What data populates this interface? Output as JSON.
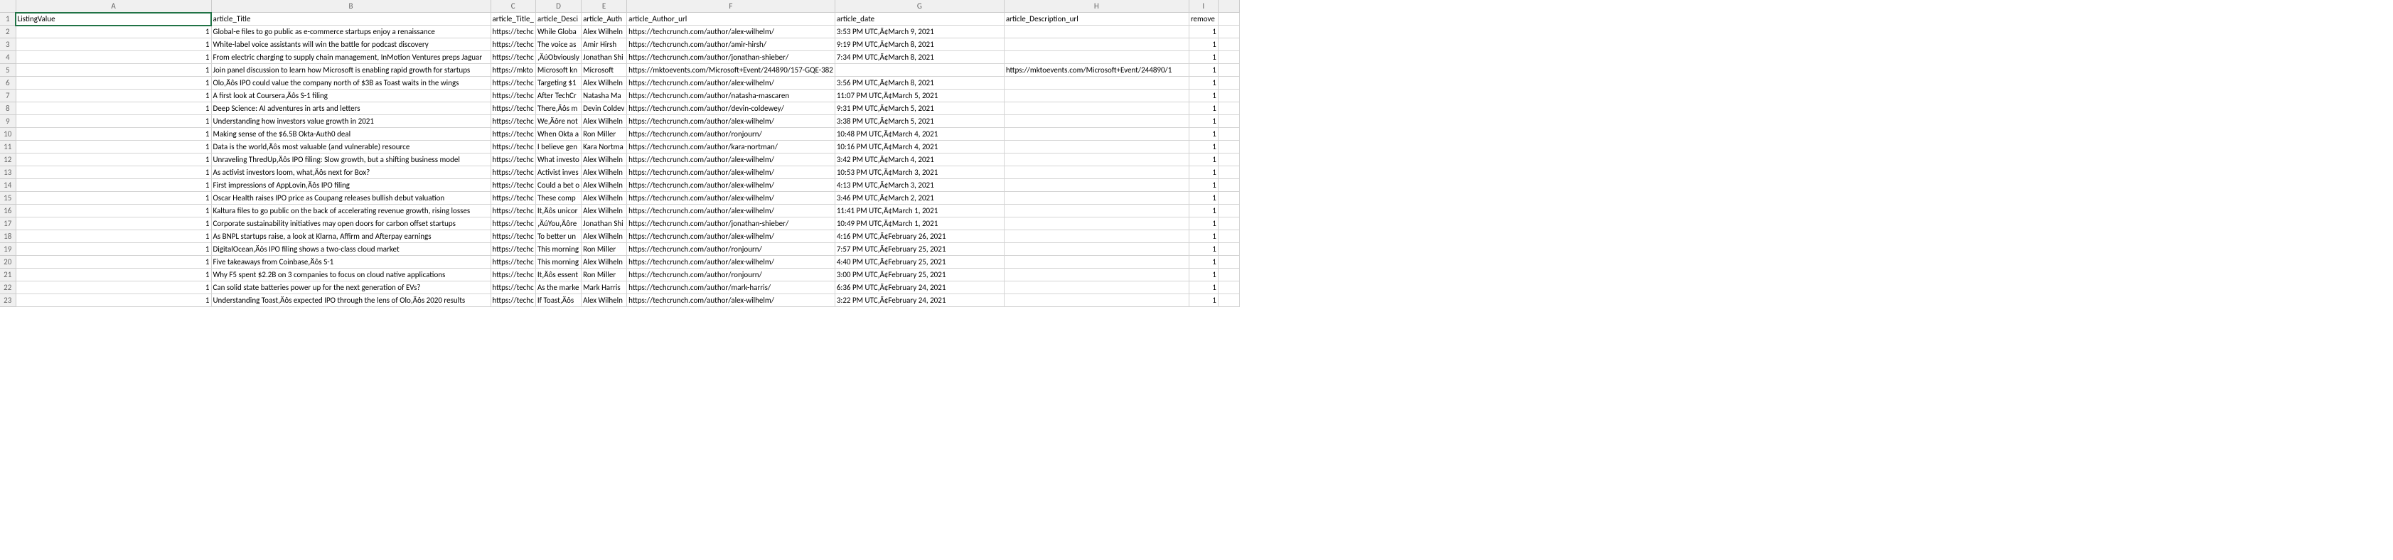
{
  "columns": [
    "A",
    "B",
    "C",
    "D",
    "E",
    "F",
    "G",
    "H",
    "I",
    ""
  ],
  "colClasses": [
    "colA",
    "colB",
    "colC",
    "colD",
    "colE",
    "colF",
    "colG",
    "colH",
    "colI",
    "colJ"
  ],
  "rowCount": 23,
  "selected": {
    "row": 1,
    "col": 0
  },
  "headers": {
    "A": "ListingValue",
    "B": "article_Title",
    "C": "article_Title_",
    "D": "article_Desci",
    "E": "article_Auth",
    "F": "article_Author_url",
    "G": "article_date",
    "H": "article_Description_url",
    "I": "remove"
  },
  "rows": [
    {
      "A": "1",
      "B": "Global-e files to go public as e-commerce startups enjoy a renaissance",
      "C": "https://techc",
      "D": "While Globa",
      "E": "Alex Wilheln",
      "F": "https://techcrunch.com/author/alex-wilhelm/",
      "G": "3:53 PM UTC‚Ä¢March 9, 2021",
      "H": "",
      "I": "1"
    },
    {
      "A": "1",
      "B": "White-label voice assistants will win the battle for podcast discovery",
      "C": "https://techc",
      "D": "The voice as",
      "E": "Amir Hirsh",
      "F": "https://techcrunch.com/author/amir-hirsh/",
      "G": "9:19 PM UTC‚Ä¢March 8, 2021",
      "H": "",
      "I": "1"
    },
    {
      "A": "1",
      "B": "From electric charging to supply chain management, InMotion Ventures preps Jaguar",
      "C": "https://techc",
      "D": "‚ÄúObviously",
      "E": "Jonathan Shi",
      "F": "https://techcrunch.com/author/jonathan-shieber/",
      "G": "7:34 PM UTC‚Ä¢March 8, 2021",
      "H": "",
      "I": "1"
    },
    {
      "A": "1",
      "B": "Join panel discussion to learn how Microsoft is enabling rapid growth for startups",
      "C": "https://mkto",
      "D": "Microsoft kn",
      "E": "Microsoft",
      "F": "https://mktoevents.com/Microsoft+Event/244890/157-GQE-382",
      "G": "",
      "H": "https://mktoevents.com/Microsoft+Event/244890/1",
      "I": "1"
    },
    {
      "A": "1",
      "B": "Olo‚Äôs IPO could value the company north of $3B as Toast waits in the wings",
      "C": "https://techc",
      "D": "Targeting $1",
      "E": "Alex Wilheln",
      "F": "https://techcrunch.com/author/alex-wilhelm/",
      "G": "3:56 PM UTC‚Ä¢March 8, 2021",
      "H": "",
      "I": "1"
    },
    {
      "A": "1",
      "B": "A first look at Coursera‚Äôs S-1 filing",
      "C": "https://techc",
      "D": "After TechCr",
      "E": "Natasha Ma",
      "F": "https://techcrunch.com/author/natasha-mascaren",
      "G": "11:07 PM UTC‚Ä¢March 5, 2021",
      "H": "",
      "I": "1"
    },
    {
      "A": "1",
      "B": "Deep Science: AI adventures in arts and letters",
      "C": "https://techc",
      "D": "There‚Äôs m",
      "E": "Devin Coldev",
      "F": "https://techcrunch.com/author/devin-coldewey/",
      "G": "9:31 PM UTC‚Ä¢March 5, 2021",
      "H": "",
      "I": "1"
    },
    {
      "A": "1",
      "B": "Understanding how investors value growth in 2021",
      "C": "https://techc",
      "D": "We‚Äôre not",
      "E": "Alex Wilheln",
      "F": "https://techcrunch.com/author/alex-wilhelm/",
      "G": "3:38 PM UTC‚Ä¢March 5, 2021",
      "H": "",
      "I": "1"
    },
    {
      "A": "1",
      "B": "Making sense of the $6.5B Okta-Auth0 deal",
      "C": "https://techc",
      "D": "When Okta a",
      "E": "Ron Miller",
      "F": "https://techcrunch.com/author/ronjourn/",
      "G": "10:48 PM UTC‚Ä¢March 4, 2021",
      "H": "",
      "I": "1"
    },
    {
      "A": "1",
      "B": "Data is the world‚Äôs most valuable (and vulnerable) resource",
      "C": "https://techc",
      "D": "I believe gen",
      "E": "Kara Nortma",
      "F": "https://techcrunch.com/author/kara-nortman/",
      "G": "10:16 PM UTC‚Ä¢March 4, 2021",
      "H": "",
      "I": "1"
    },
    {
      "A": "1",
      "B": "Unraveling ThredUp‚Äôs IPO filing: Slow growth, but a shifting business model",
      "C": "https://techc",
      "D": "What investo",
      "E": "Alex Wilheln",
      "F": "https://techcrunch.com/author/alex-wilhelm/",
      "G": "3:42 PM UTC‚Ä¢March 4, 2021",
      "H": "",
      "I": "1"
    },
    {
      "A": "1",
      "B": "As activist investors loom, what‚Äôs next for Box?",
      "C": "https://techc",
      "D": "Activist inves",
      "E": "Alex Wilheln",
      "F": "https://techcrunch.com/author/alex-wilhelm/",
      "G": "10:53 PM UTC‚Ä¢March 3, 2021",
      "H": "",
      "I": "1"
    },
    {
      "A": "1",
      "B": "First impressions of AppLovin‚Äôs IPO filing",
      "C": "https://techc",
      "D": "Could a bet o",
      "E": "Alex Wilheln",
      "F": "https://techcrunch.com/author/alex-wilhelm/",
      "G": "4:13 PM UTC‚Ä¢March 3, 2021",
      "H": "",
      "I": "1"
    },
    {
      "A": "1",
      "B": "Oscar Health raises IPO price as Coupang releases bullish debut valuation",
      "C": "https://techc",
      "D": "These comp",
      "E": "Alex Wilheln",
      "F": "https://techcrunch.com/author/alex-wilhelm/",
      "G": "3:46 PM UTC‚Ä¢March 2, 2021",
      "H": "",
      "I": "1"
    },
    {
      "A": "1",
      "B": "Kaltura files to go public on the back of accelerating revenue growth, rising losses",
      "C": "https://techc",
      "D": "It‚Äôs unicor",
      "E": "Alex Wilheln",
      "F": "https://techcrunch.com/author/alex-wilhelm/",
      "G": "11:41 PM UTC‚Ä¢March 1, 2021",
      "H": "",
      "I": "1"
    },
    {
      "A": "1",
      "B": "Corporate sustainability initiatives may open doors for carbon offset startups",
      "C": "https://techc",
      "D": "‚ÄúYou‚Äôre",
      "E": "Jonathan Shi",
      "F": "https://techcrunch.com/author/jonathan-shieber/",
      "G": "10:49 PM UTC‚Ä¢March 1, 2021",
      "H": "",
      "I": "1"
    },
    {
      "A": "1",
      "B": "As BNPL startups raise, a look at Klarna, Affirm and Afterpay earnings",
      "C": "https://techc",
      "D": "To better un",
      "E": "Alex Wilheln",
      "F": "https://techcrunch.com/author/alex-wilhelm/",
      "G": "4:16 PM UTC‚Ä¢February 26, 2021",
      "H": "",
      "I": "1"
    },
    {
      "A": "1",
      "B": "DigitalOcean‚Äôs IPO filing shows a two-class cloud market",
      "C": "https://techc",
      "D": "This morning",
      "E": "Ron Miller",
      "F": "https://techcrunch.com/author/ronjourn/",
      "G": "7:57 PM UTC‚Ä¢February 25, 2021",
      "H": "",
      "I": "1"
    },
    {
      "A": "1",
      "B": "Five takeaways from Coinbase‚Äôs S-1",
      "C": "https://techc",
      "D": "This morning",
      "E": "Alex Wilheln",
      "F": "https://techcrunch.com/author/alex-wilhelm/",
      "G": "4:40 PM UTC‚Ä¢February 25, 2021",
      "H": "",
      "I": "1"
    },
    {
      "A": "1",
      "B": "Why F5 spent $2.2B on 3 companies to focus on cloud native applications",
      "C": "https://techc",
      "D": "It‚Äôs essent",
      "E": "Ron Miller",
      "F": "https://techcrunch.com/author/ronjourn/",
      "G": "3:00 PM UTC‚Ä¢February 25, 2021",
      "H": "",
      "I": "1"
    },
    {
      "A": "1",
      "B": "Can solid state batteries power up for the next generation of EVs?",
      "C": "https://techc",
      "D": "As the marke",
      "E": "Mark Harris",
      "F": "https://techcrunch.com/author/mark-harris/",
      "G": "6:36 PM UTC‚Ä¢February 24, 2021",
      "H": "",
      "I": "1"
    },
    {
      "A": "1",
      "B": "Understanding Toast‚Äôs expected IPO through the lens of Olo‚Äôs 2020 results",
      "C": "https://techc",
      "D": "If Toast‚Äôs",
      "E": "Alex Wilheln",
      "F": "https://techcrunch.com/author/alex-wilhelm/",
      "G": "3:22 PM UTC‚Ä¢February 24, 2021",
      "H": "",
      "I": "1"
    }
  ]
}
